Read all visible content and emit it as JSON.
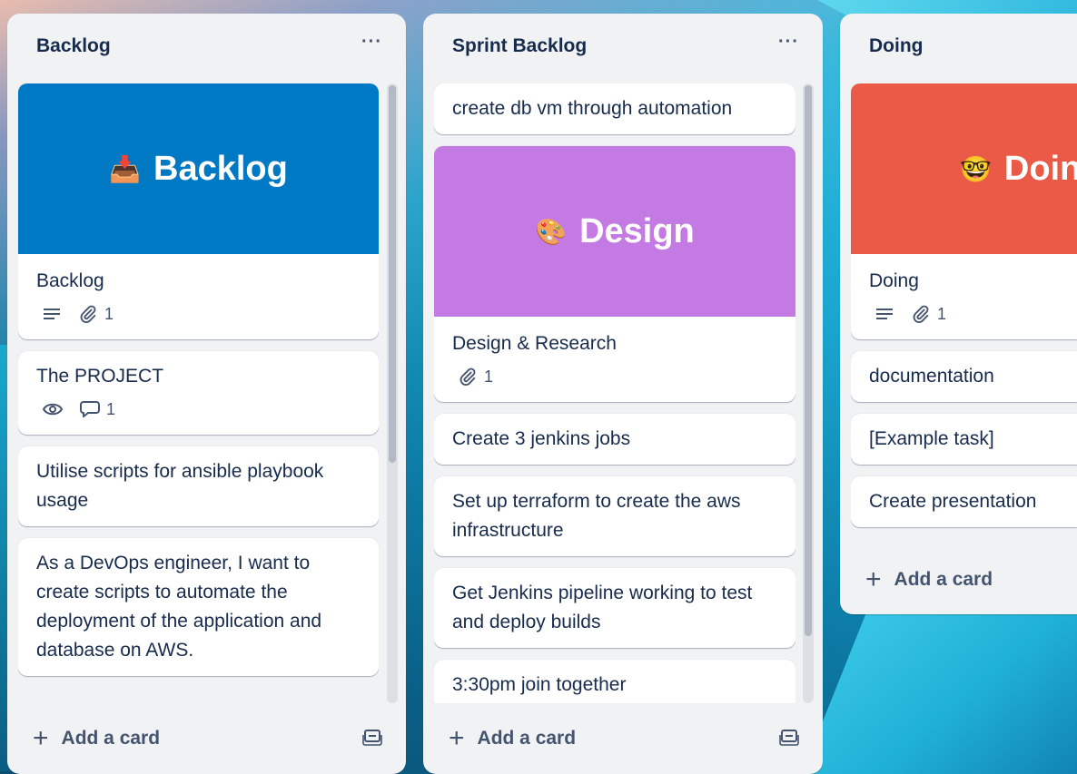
{
  "lists": [
    {
      "title": "Backlog",
      "menu": "···",
      "add_card": "Add a card",
      "cover": {
        "emoji": "📥",
        "title": "Backlog",
        "color": "#0079c4"
      },
      "cards": [
        {
          "title": "Backlog",
          "attachments": "1"
        },
        {
          "title": "The PROJECT",
          "comments": "1"
        },
        {
          "title": "Utilise scripts for ansible playbook usage"
        },
        {
          "title": "As a DevOps engineer, I want to create scripts to automate the deployment of the application and database on AWS."
        }
      ]
    },
    {
      "title": "Sprint Backlog",
      "menu": "···",
      "add_card": "Add a card",
      "cover": {
        "emoji": "🎨",
        "title": "Design",
        "color": "#c37ae2"
      },
      "cards": [
        {
          "title": "create db vm through automation"
        },
        {
          "title": "Design & Research",
          "attachments": "1"
        },
        {
          "title": "Create 3 jenkins jobs"
        },
        {
          "title": "Set up terraform to create the aws infrastructure"
        },
        {
          "title": "Get Jenkins pipeline working to test and deploy builds"
        },
        {
          "title": "3:30pm join together"
        }
      ]
    },
    {
      "title": "Doing",
      "add_card": "Add a card",
      "cover": {
        "emoji": "🤓",
        "title": "Doing",
        "color": "#ea5a47"
      },
      "cards": [
        {
          "title": "Doing",
          "attachments": "1"
        },
        {
          "title": "documentation"
        },
        {
          "title": "[Example task]"
        },
        {
          "title": "Create presentation"
        }
      ]
    }
  ]
}
